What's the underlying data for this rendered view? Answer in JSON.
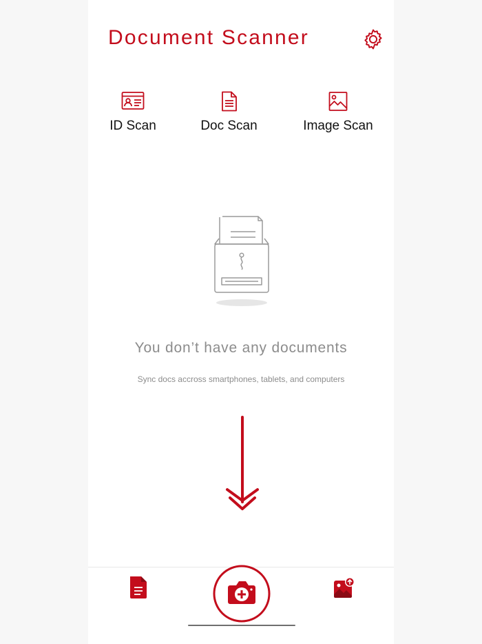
{
  "header": {
    "title": "Document Scanner",
    "settings_icon": "gear-icon"
  },
  "scan_options": [
    {
      "label": "ID Scan",
      "icon": "id-card-icon"
    },
    {
      "label": "Doc Scan",
      "icon": "document-icon"
    },
    {
      "label": "Image Scan",
      "icon": "image-icon"
    }
  ],
  "empty_state": {
    "illustration": "scanner-illustration",
    "title": "You don’t have any documents",
    "subtitle": "Sync docs accross smartphones, tablets, and computers"
  },
  "hint_arrow_icon": "arrow-down-icon",
  "tab_bar": {
    "documents_icon": "document-icon",
    "camera_icon": "camera-add-icon",
    "gallery_icon": "image-upload-icon"
  },
  "colors": {
    "accent": "#c30d1c",
    "muted_text": "#8c8c8c",
    "illustration_stroke": "#9a9a9a"
  }
}
